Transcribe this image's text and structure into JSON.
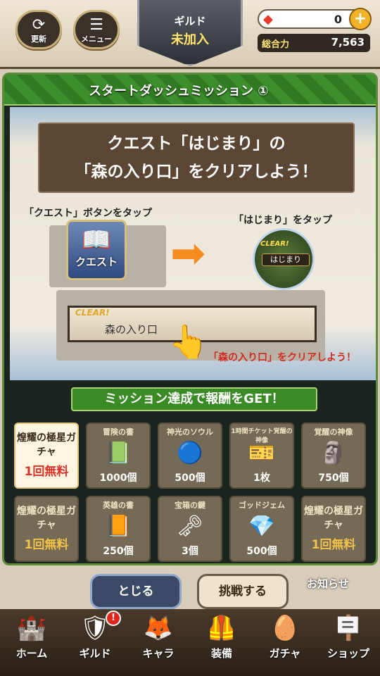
{
  "header": {
    "refresh_label": "更新",
    "menu_label": "メニュー",
    "guild_title": "ギルド",
    "guild_status": "未加入",
    "gems": "0",
    "power_label": "総合力",
    "power_value": "7,563"
  },
  "modal": {
    "title": "スタートダッシュミッション ①",
    "quest_line1": "クエスト「はじまり」の",
    "quest_line2": "「森の入り口」をクリアしよう！",
    "step1": "「クエスト」ボタンをタップ",
    "quest_icon_label": "クエスト",
    "step2": "「はじまり」をタップ",
    "clear_tag": "CLEAR!",
    "hajimari": "はじまり",
    "mori": "森の入り口",
    "step3": "「森の入り口」をクリアしよう！",
    "reward_title": "ミッション達成で報酬をGET！",
    "rewards": [
      {
        "name": "煌耀の極星ガチャ",
        "count": "1回無料",
        "icon": "ticket-icon"
      },
      {
        "name": "冒険の書",
        "count": "1000個",
        "icon": "book-icon"
      },
      {
        "name": "神光のソウル",
        "count": "500個",
        "icon": "soul-icon"
      },
      {
        "name": "1時間チケット覚醒の神像",
        "count": "1枚",
        "icon": "ticket-icon"
      },
      {
        "name": "覚醒の神像",
        "count": "750個",
        "icon": "statue-icon"
      },
      {
        "name": "煌耀の極星ガチャ",
        "count": "1回無料",
        "icon": "ticket-icon"
      },
      {
        "name": "英雄の書",
        "count": "250個",
        "icon": "book-icon"
      },
      {
        "name": "宝箱の鍵",
        "count": "3個",
        "icon": "key-icon"
      },
      {
        "name": "ゴッドジェム",
        "count": "500個",
        "icon": "gem-icon"
      },
      {
        "name": "煌耀の極星ガチャ",
        "count": "1回無料",
        "icon": "ticket-icon"
      }
    ]
  },
  "actions": {
    "close": "とじる",
    "challenge": "挑戦する",
    "notice": "お知らせ"
  },
  "nav": {
    "home": "ホーム",
    "guild": "ギルド",
    "guild_badge": "!",
    "chara": "キャラ",
    "equip": "装備",
    "gacha": "ガチャ",
    "shop": "ショップ"
  }
}
